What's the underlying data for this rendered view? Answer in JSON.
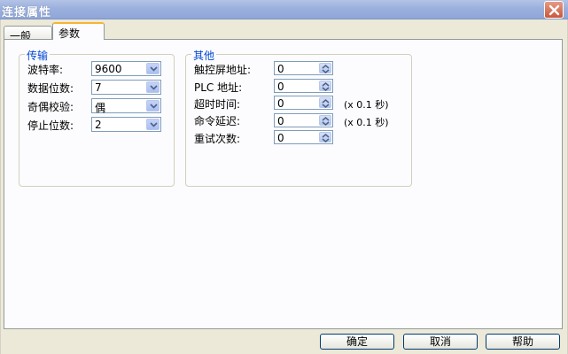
{
  "window": {
    "title": "连接属性",
    "close_icon": "close-icon"
  },
  "tabs": [
    {
      "label": "一般",
      "active": false
    },
    {
      "label": "参数",
      "active": true
    }
  ],
  "transmission": {
    "title": "传输",
    "fields": [
      {
        "label": "波特率:",
        "value": "9600"
      },
      {
        "label": "数据位数:",
        "value": "7"
      },
      {
        "label": "奇偶校验:",
        "value": "偶"
      },
      {
        "label": "停止位数:",
        "value": "2"
      }
    ]
  },
  "other": {
    "title": "其他",
    "fields": [
      {
        "label": "触控屏地址:",
        "value": "0",
        "unit": ""
      },
      {
        "label": "PLC 地址:",
        "value": "0",
        "unit": ""
      },
      {
        "label": "超时时间:",
        "value": "0",
        "unit": "(x 0.1 秒)"
      },
      {
        "label": "命令延迟:",
        "value": "0",
        "unit": "(x 0.1 秒)"
      },
      {
        "label": "重试次数:",
        "value": "0",
        "unit": ""
      }
    ]
  },
  "buttons": {
    "ok": "确定",
    "cancel": "取消",
    "help": "帮助"
  },
  "colors": {
    "title_bar": "#9bb0dd",
    "group_title": "#0046d5",
    "active_tab_accent": "#f8b435"
  }
}
